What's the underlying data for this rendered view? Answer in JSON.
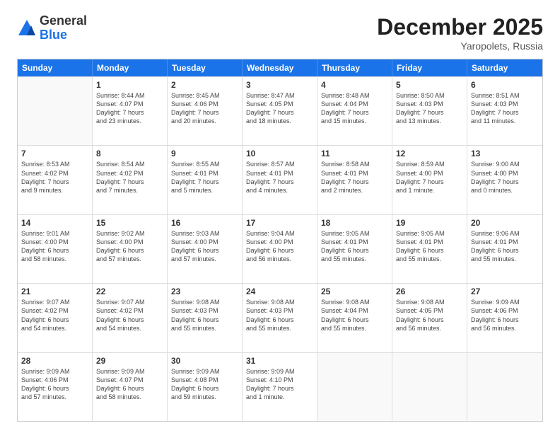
{
  "logo": {
    "general": "General",
    "blue": "Blue"
  },
  "title": "December 2025",
  "location": "Yaropolets, Russia",
  "days": [
    "Sunday",
    "Monday",
    "Tuesday",
    "Wednesday",
    "Thursday",
    "Friday",
    "Saturday"
  ],
  "weeks": [
    [
      {
        "day": "",
        "lines": []
      },
      {
        "day": "1",
        "lines": [
          "Sunrise: 8:44 AM",
          "Sunset: 4:07 PM",
          "Daylight: 7 hours",
          "and 23 minutes."
        ]
      },
      {
        "day": "2",
        "lines": [
          "Sunrise: 8:45 AM",
          "Sunset: 4:06 PM",
          "Daylight: 7 hours",
          "and 20 minutes."
        ]
      },
      {
        "day": "3",
        "lines": [
          "Sunrise: 8:47 AM",
          "Sunset: 4:05 PM",
          "Daylight: 7 hours",
          "and 18 minutes."
        ]
      },
      {
        "day": "4",
        "lines": [
          "Sunrise: 8:48 AM",
          "Sunset: 4:04 PM",
          "Daylight: 7 hours",
          "and 15 minutes."
        ]
      },
      {
        "day": "5",
        "lines": [
          "Sunrise: 8:50 AM",
          "Sunset: 4:03 PM",
          "Daylight: 7 hours",
          "and 13 minutes."
        ]
      },
      {
        "day": "6",
        "lines": [
          "Sunrise: 8:51 AM",
          "Sunset: 4:03 PM",
          "Daylight: 7 hours",
          "and 11 minutes."
        ]
      }
    ],
    [
      {
        "day": "7",
        "lines": [
          "Sunrise: 8:53 AM",
          "Sunset: 4:02 PM",
          "Daylight: 7 hours",
          "and 9 minutes."
        ]
      },
      {
        "day": "8",
        "lines": [
          "Sunrise: 8:54 AM",
          "Sunset: 4:02 PM",
          "Daylight: 7 hours",
          "and 7 minutes."
        ]
      },
      {
        "day": "9",
        "lines": [
          "Sunrise: 8:55 AM",
          "Sunset: 4:01 PM",
          "Daylight: 7 hours",
          "and 5 minutes."
        ]
      },
      {
        "day": "10",
        "lines": [
          "Sunrise: 8:57 AM",
          "Sunset: 4:01 PM",
          "Daylight: 7 hours",
          "and 4 minutes."
        ]
      },
      {
        "day": "11",
        "lines": [
          "Sunrise: 8:58 AM",
          "Sunset: 4:01 PM",
          "Daylight: 7 hours",
          "and 2 minutes."
        ]
      },
      {
        "day": "12",
        "lines": [
          "Sunrise: 8:59 AM",
          "Sunset: 4:00 PM",
          "Daylight: 7 hours",
          "and 1 minute."
        ]
      },
      {
        "day": "13",
        "lines": [
          "Sunrise: 9:00 AM",
          "Sunset: 4:00 PM",
          "Daylight: 7 hours",
          "and 0 minutes."
        ]
      }
    ],
    [
      {
        "day": "14",
        "lines": [
          "Sunrise: 9:01 AM",
          "Sunset: 4:00 PM",
          "Daylight: 6 hours",
          "and 58 minutes."
        ]
      },
      {
        "day": "15",
        "lines": [
          "Sunrise: 9:02 AM",
          "Sunset: 4:00 PM",
          "Daylight: 6 hours",
          "and 57 minutes."
        ]
      },
      {
        "day": "16",
        "lines": [
          "Sunrise: 9:03 AM",
          "Sunset: 4:00 PM",
          "Daylight: 6 hours",
          "and 57 minutes."
        ]
      },
      {
        "day": "17",
        "lines": [
          "Sunrise: 9:04 AM",
          "Sunset: 4:00 PM",
          "Daylight: 6 hours",
          "and 56 minutes."
        ]
      },
      {
        "day": "18",
        "lines": [
          "Sunrise: 9:05 AM",
          "Sunset: 4:01 PM",
          "Daylight: 6 hours",
          "and 55 minutes."
        ]
      },
      {
        "day": "19",
        "lines": [
          "Sunrise: 9:05 AM",
          "Sunset: 4:01 PM",
          "Daylight: 6 hours",
          "and 55 minutes."
        ]
      },
      {
        "day": "20",
        "lines": [
          "Sunrise: 9:06 AM",
          "Sunset: 4:01 PM",
          "Daylight: 6 hours",
          "and 55 minutes."
        ]
      }
    ],
    [
      {
        "day": "21",
        "lines": [
          "Sunrise: 9:07 AM",
          "Sunset: 4:02 PM",
          "Daylight: 6 hours",
          "and 54 minutes."
        ]
      },
      {
        "day": "22",
        "lines": [
          "Sunrise: 9:07 AM",
          "Sunset: 4:02 PM",
          "Daylight: 6 hours",
          "and 54 minutes."
        ]
      },
      {
        "day": "23",
        "lines": [
          "Sunrise: 9:08 AM",
          "Sunset: 4:03 PM",
          "Daylight: 6 hours",
          "and 55 minutes."
        ]
      },
      {
        "day": "24",
        "lines": [
          "Sunrise: 9:08 AM",
          "Sunset: 4:03 PM",
          "Daylight: 6 hours",
          "and 55 minutes."
        ]
      },
      {
        "day": "25",
        "lines": [
          "Sunrise: 9:08 AM",
          "Sunset: 4:04 PM",
          "Daylight: 6 hours",
          "and 55 minutes."
        ]
      },
      {
        "day": "26",
        "lines": [
          "Sunrise: 9:08 AM",
          "Sunset: 4:05 PM",
          "Daylight: 6 hours",
          "and 56 minutes."
        ]
      },
      {
        "day": "27",
        "lines": [
          "Sunrise: 9:09 AM",
          "Sunset: 4:06 PM",
          "Daylight: 6 hours",
          "and 56 minutes."
        ]
      }
    ],
    [
      {
        "day": "28",
        "lines": [
          "Sunrise: 9:09 AM",
          "Sunset: 4:06 PM",
          "Daylight: 6 hours",
          "and 57 minutes."
        ]
      },
      {
        "day": "29",
        "lines": [
          "Sunrise: 9:09 AM",
          "Sunset: 4:07 PM",
          "Daylight: 6 hours",
          "and 58 minutes."
        ]
      },
      {
        "day": "30",
        "lines": [
          "Sunrise: 9:09 AM",
          "Sunset: 4:08 PM",
          "Daylight: 6 hours",
          "and 59 minutes."
        ]
      },
      {
        "day": "31",
        "lines": [
          "Sunrise: 9:09 AM",
          "Sunset: 4:10 PM",
          "Daylight: 7 hours",
          "and 1 minute."
        ]
      },
      {
        "day": "",
        "lines": []
      },
      {
        "day": "",
        "lines": []
      },
      {
        "day": "",
        "lines": []
      }
    ]
  ]
}
